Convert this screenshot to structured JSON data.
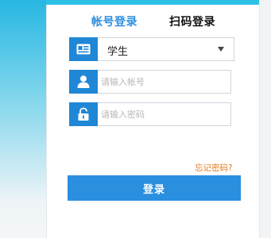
{
  "tabs": {
    "account_login": "帐号登录",
    "qr_login": "扫码登录"
  },
  "form": {
    "role_select": {
      "selected": "学生"
    },
    "username": {
      "placeholder": "请输入帐号",
      "value": ""
    },
    "password": {
      "placeholder": "请输入密码",
      "value": ""
    }
  },
  "links": {
    "forgot_password": "忘记密码?"
  },
  "buttons": {
    "login": "登录"
  },
  "icons": {
    "role": "id-card-icon",
    "user": "user-icon",
    "password": "lock-icon",
    "dropdown": "caret-down-icon"
  },
  "colors": {
    "accent": "#2b8fe0",
    "icon_bg": "#1f87d6",
    "active_tab": "#2f8fe0",
    "link": "#e07a1f"
  }
}
